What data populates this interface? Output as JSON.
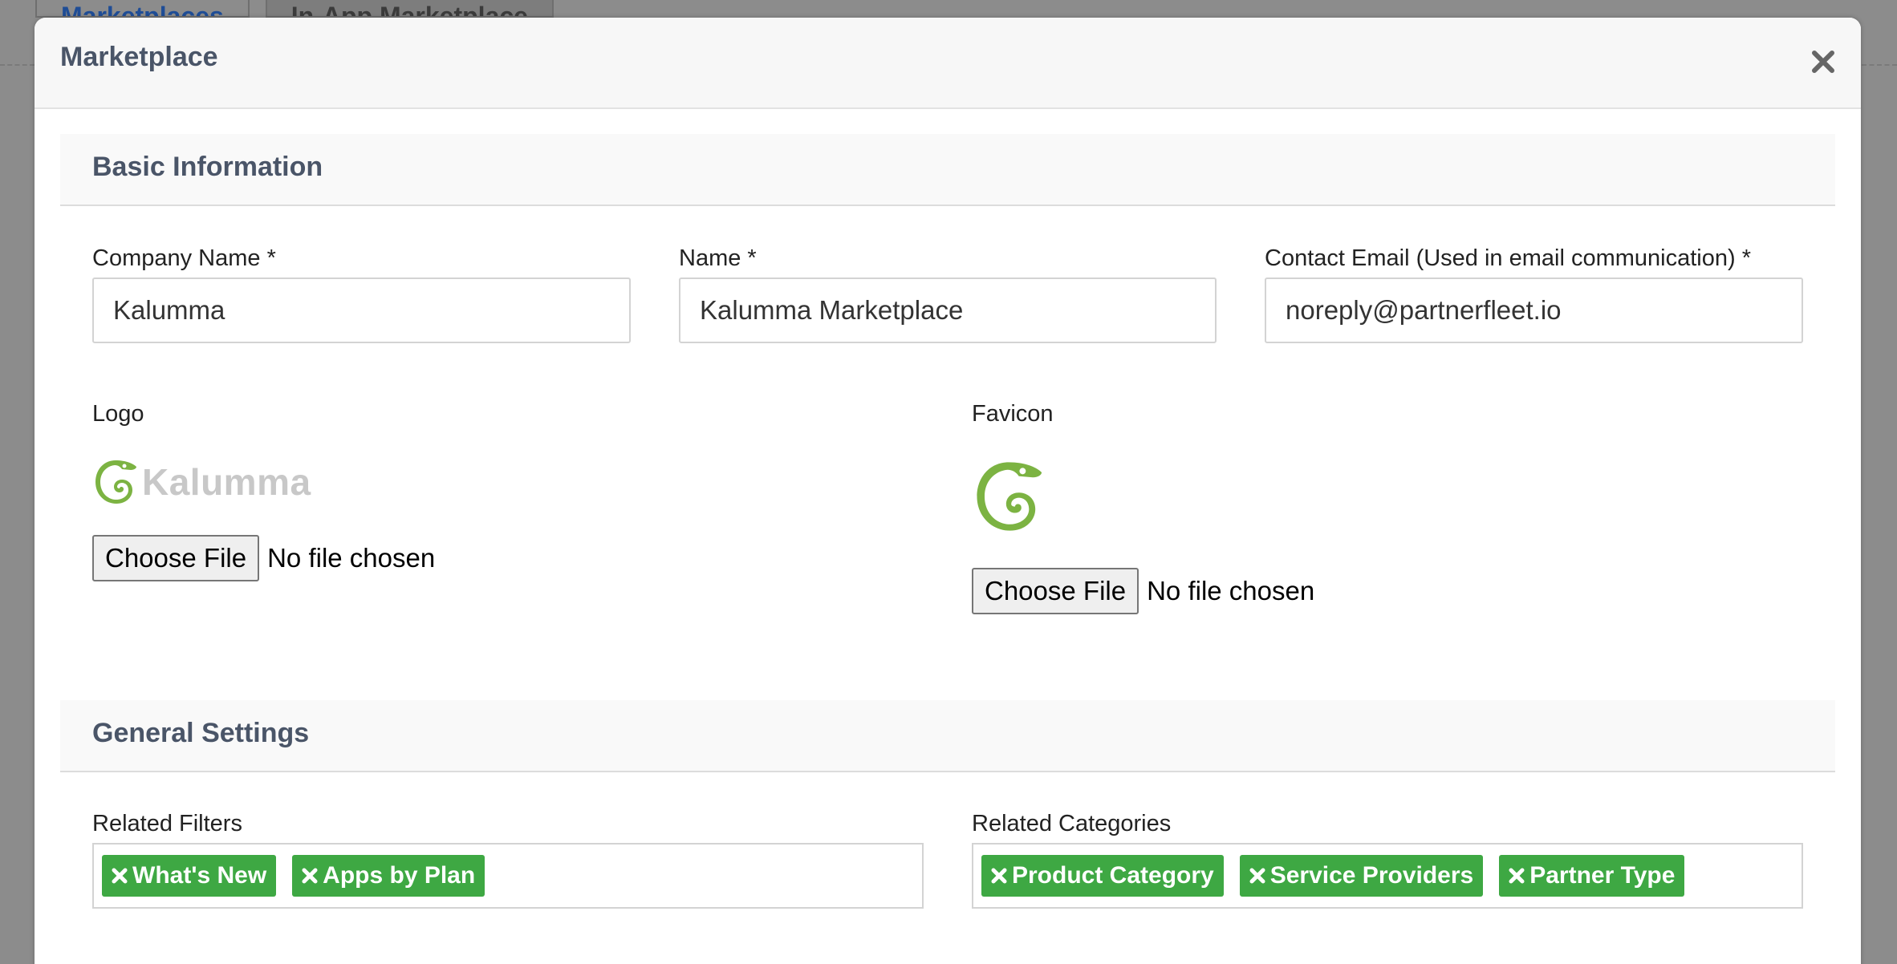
{
  "background": {
    "tabs": [
      {
        "label": "Marketplaces"
      },
      {
        "label": "In-App Marketplace"
      }
    ]
  },
  "modal": {
    "title": "Marketplace",
    "close_icon": "close-icon"
  },
  "basic_information": {
    "heading": "Basic Information",
    "company_name": {
      "label": "Company Name *",
      "value": "Kalumma"
    },
    "name": {
      "label": "Name *",
      "value": "Kalumma Marketplace"
    },
    "contact_email": {
      "label": "Contact Email (Used in email communication) *",
      "value": "noreply@partnerfleet.io"
    },
    "logo": {
      "label": "Logo",
      "logo_text": "Kalumma",
      "icon": "chameleon-icon",
      "file_button": "Choose File",
      "file_status": "No file chosen"
    },
    "favicon": {
      "label": "Favicon",
      "icon": "chameleon-icon",
      "file_button": "Choose File",
      "file_status": "No file chosen"
    }
  },
  "general_settings": {
    "heading": "General Settings",
    "related_filters": {
      "label": "Related Filters",
      "tags": [
        "What's New",
        "Apps by Plan"
      ]
    },
    "related_categories": {
      "label": "Related Categories",
      "tags": [
        "Product Category",
        "Service Providers",
        "Partner Type"
      ]
    }
  },
  "colors": {
    "tag_green": "#3ea843",
    "brand_green": "#7cb342",
    "heading_text": "#4a5568",
    "overlay": "#8c8c8c"
  }
}
